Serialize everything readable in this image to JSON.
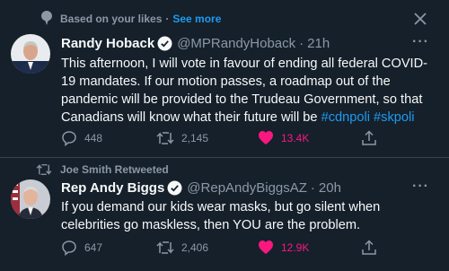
{
  "context": {
    "text": "Based on your likes",
    "separator": "·",
    "link": "See more"
  },
  "tweets": [
    {
      "name": "Randy Hoback",
      "handle": "@MPRandyHoback",
      "time": "21h",
      "separator": "·",
      "more": "···",
      "text_plain": "This afternoon, I will vote in favour of ending all federal COVID-19 mandates. If our motion passes, a roadmap out of the pandemic will be provided to the Trudeau Government, so that Canadians will know what their future will be ",
      "hashtags": [
        "#cdnpoli",
        "#skpoli"
      ],
      "replies": "448",
      "retweets": "2,145",
      "likes": "13.4K"
    },
    {
      "context": "Joe Smith Retweeted",
      "name": "Rep Andy Biggs",
      "handle": "@RepAndyBiggsAZ",
      "time": "20h",
      "separator": "·",
      "more": "···",
      "text_plain": "If you demand our kids wear masks, but go silent when celebrities go maskless, then YOU are the problem.",
      "replies": "647",
      "retweets": "2,406",
      "likes": "12.9K"
    }
  ],
  "colors": {
    "bg": "#15202b",
    "text": "#f7f9f9",
    "muted": "#8b98a5",
    "link": "#1d9bf0",
    "like": "#f91880",
    "border": "#38444d"
  },
  "icons": [
    "sparkle-icon",
    "close-icon",
    "verified-icon",
    "reply-icon",
    "retweet-icon",
    "like-icon",
    "share-icon",
    "more-icon"
  ]
}
